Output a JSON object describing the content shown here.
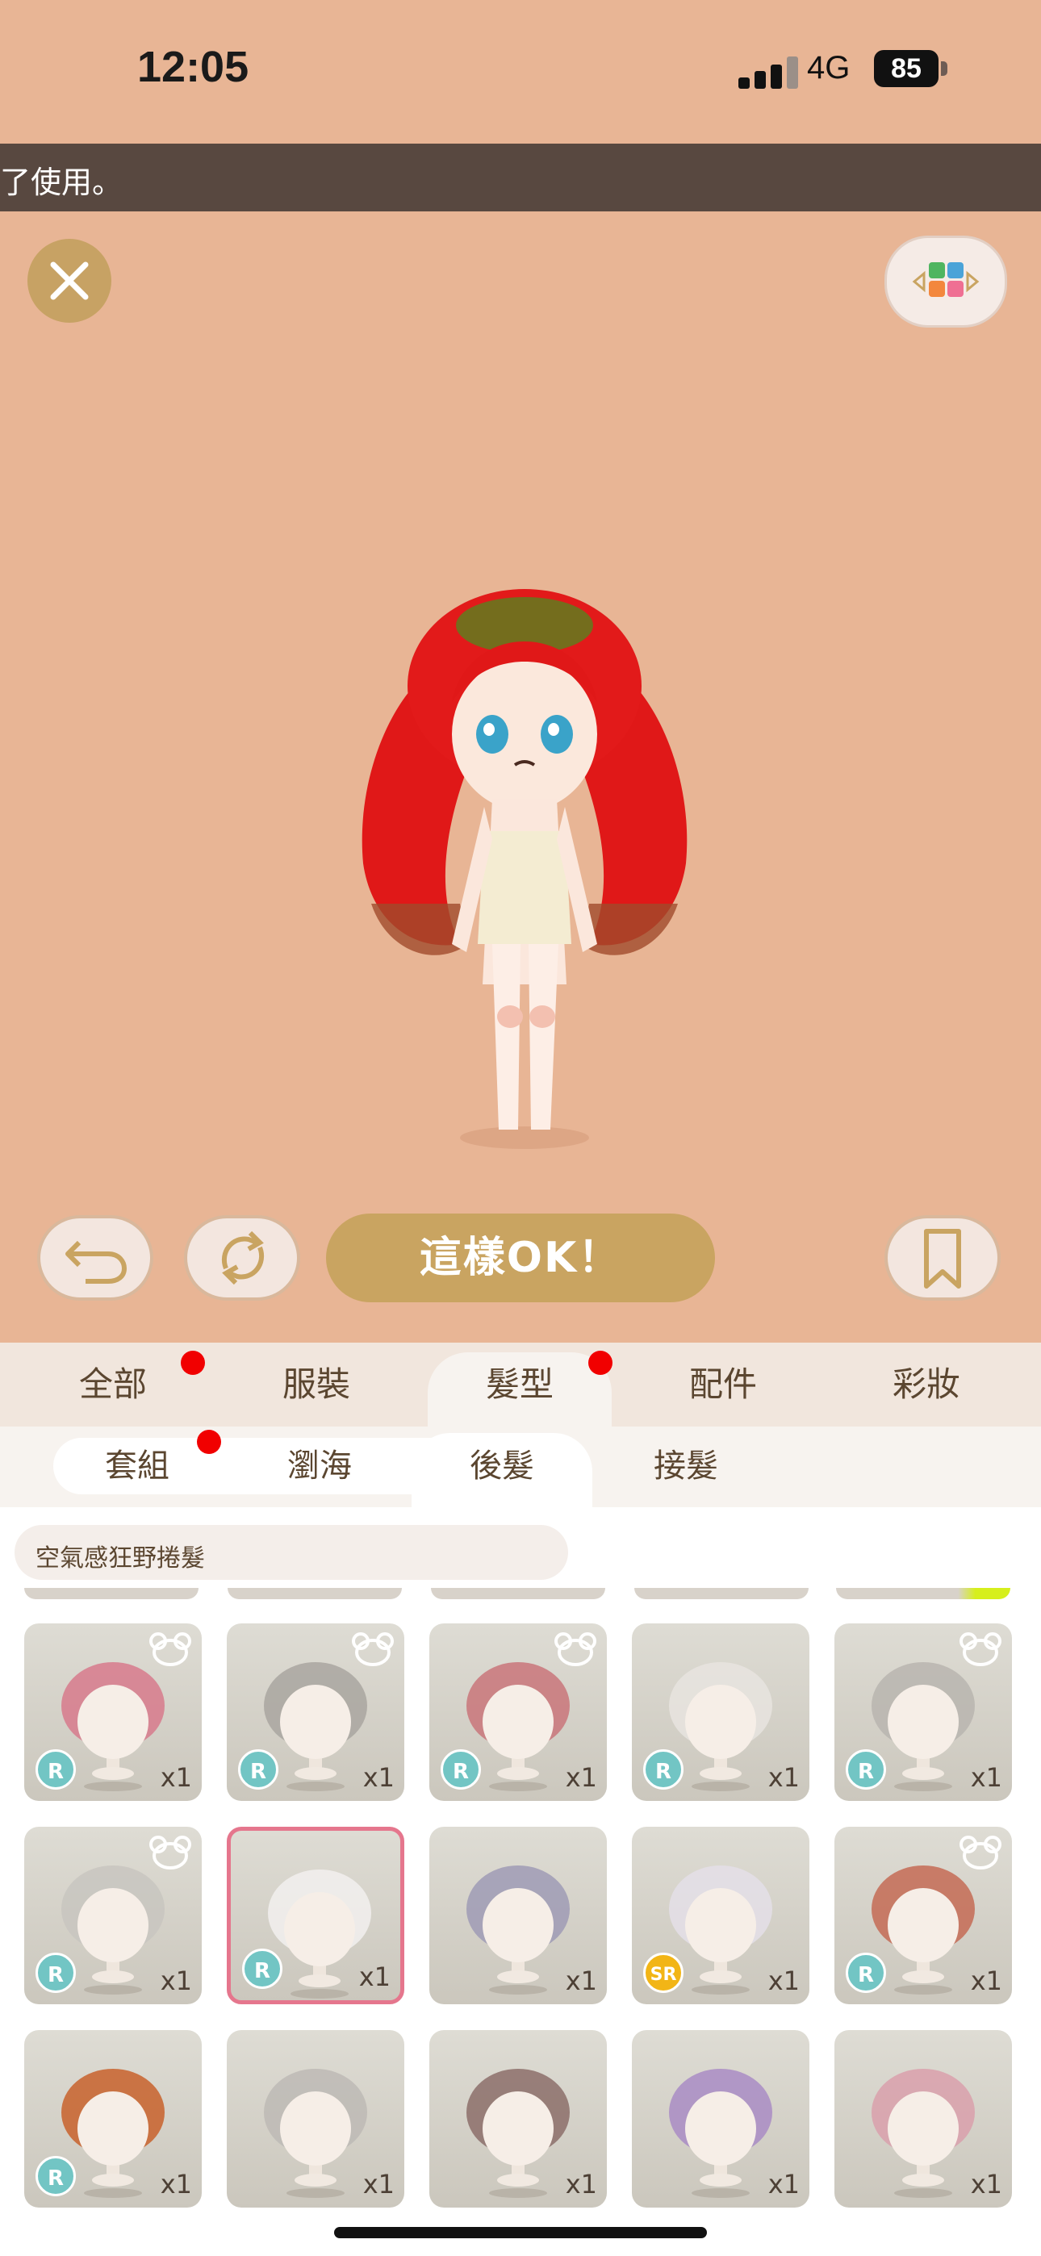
{
  "status_bar": {
    "time": "12:05",
    "network": "4G",
    "battery": "85"
  },
  "notice": {
    "text": "了使用。"
  },
  "actions": {
    "ok_label": "這樣OK！"
  },
  "icons": {
    "close": "close-icon",
    "color_grid": "color-grid-icon",
    "undo": "undo-icon",
    "refresh": "refresh-icon",
    "bookmark": "bookmark-icon"
  },
  "tabs": [
    {
      "label": "全部",
      "dot": true
    },
    {
      "label": "服裝",
      "dot": false
    },
    {
      "label": "髮型",
      "dot": true,
      "active": true
    },
    {
      "label": "配件",
      "dot": false
    },
    {
      "label": "彩妝",
      "dot": false
    }
  ],
  "subtabs": [
    {
      "label": "套組",
      "dot": true
    },
    {
      "label": "瀏海"
    },
    {
      "label": "後髮",
      "active": true
    },
    {
      "label": "接髮"
    }
  ],
  "selected_item_name": "空氣感狂野捲髮",
  "items": [
    {
      "rarity": "R",
      "qty": "x1",
      "hair": "#d77a8c",
      "bear": true
    },
    {
      "rarity": "R",
      "qty": "x1",
      "hair": "#a9a6a0",
      "bear": true
    },
    {
      "rarity": "R",
      "qty": "x1",
      "hair": "#c9767a",
      "bear": true
    },
    {
      "rarity": "R",
      "qty": "x1",
      "hair": "#e8e4df",
      "bear": false
    },
    {
      "rarity": "R",
      "qty": "x1",
      "hair": "#b8b5af",
      "bear": true
    },
    {
      "rarity": "R",
      "qty": "x1",
      "hair": "#c8c5bf",
      "bear": true
    },
    {
      "rarity": "R",
      "qty": "x1",
      "hair": "#f2f0ee",
      "bear": false,
      "selected": true
    },
    {
      "rarity": "",
      "qty": "x1",
      "hair": "#9f9bb5",
      "bear": false
    },
    {
      "rarity": "SR",
      "qty": "x1",
      "hair": "#e4dfe8",
      "bear": false
    },
    {
      "rarity": "R",
      "qty": "x1",
      "hair": "#c46b55",
      "bear": true
    },
    {
      "rarity": "R",
      "qty": "x1",
      "hair": "#c8612c",
      "bear": false
    },
    {
      "rarity": "",
      "qty": "x1",
      "hair": "#bdbab5",
      "bear": false
    },
    {
      "rarity": "",
      "qty": "x1",
      "hair": "#8c6f6a",
      "bear": false
    },
    {
      "rarity": "",
      "qty": "x1",
      "hair": "#a98cc4",
      "bear": false
    },
    {
      "rarity": "",
      "qty": "x1",
      "hair": "#d9a0ac",
      "bear": false
    }
  ]
}
